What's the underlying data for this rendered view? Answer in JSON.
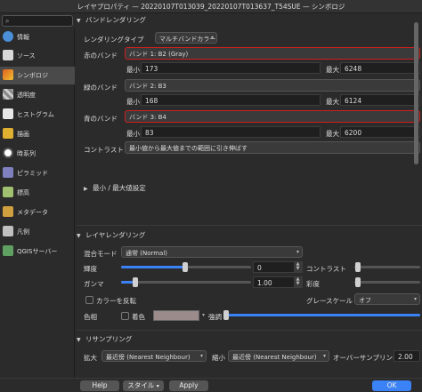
{
  "window": {
    "title": "レイヤプロパティ — 20220107T013039_20220107T013637_T54SUE — シンボロジ"
  },
  "sidebar": {
    "search_placeholder": "",
    "items": [
      {
        "label": "情報",
        "icon": "info-icon",
        "color": "#4a90d9"
      },
      {
        "label": "ソース",
        "icon": "source-icon",
        "color": "#e0e0e0"
      },
      {
        "label": "シンボロジ",
        "icon": "symbology-icon",
        "color": "#e06020"
      },
      {
        "label": "透明度",
        "icon": "transparency-icon",
        "color": "#8a8a8a"
      },
      {
        "label": "ヒストグラム",
        "icon": "histogram-icon",
        "color": "#6aa0d0"
      },
      {
        "label": "描画",
        "icon": "rendering-icon",
        "color": "#e0b030"
      },
      {
        "label": "時系列",
        "icon": "temporal-icon",
        "color": "#e0e0e0"
      },
      {
        "label": "ピラミッド",
        "icon": "pyramid-icon",
        "color": "#8080c0"
      },
      {
        "label": "標高",
        "icon": "elevation-icon",
        "color": "#a0c070"
      },
      {
        "label": "メタデータ",
        "icon": "metadata-icon",
        "color": "#d0a040"
      },
      {
        "label": "凡例",
        "icon": "legend-icon",
        "color": "#c0c0c0"
      },
      {
        "label": "QGISサーバー",
        "icon": "server-icon",
        "color": "#60a060"
      }
    ]
  },
  "band_rendering": {
    "header": "バンドレンダリング",
    "render_type_label": "レンダリングタイプ",
    "render_type_value": "マルチバンドカラー",
    "red_label": "赤のバンド",
    "red_value": "バンド 1: B2 (Gray)",
    "red_min_label": "最小",
    "red_min": "173",
    "red_max_label": "最大",
    "red_max": "6248",
    "green_label": "緑のバンド",
    "green_value": "バンド 2: B3",
    "green_min_label": "最小",
    "green_min": "168",
    "green_max_label": "最大",
    "green_max": "6124",
    "blue_label": "青のバンド",
    "blue_value": "バンド 3: B4",
    "blue_min_label": "最小",
    "blue_min": "83",
    "blue_max_label": "最大",
    "blue_max": "6200",
    "contrast_label": "コントラスト",
    "contrast_value": "最小値から最大値までの範囲に引き伸ばす",
    "minmax_label": "最小 / 最大値設定"
  },
  "layer_rendering": {
    "header": "レイヤレンダリング",
    "blend_label": "混合モード",
    "blend_value": "通常 (Normal)",
    "brightness_label": "輝度",
    "brightness_value": "0",
    "contrast_label": "コントラスト",
    "gamma_label": "ガンマ",
    "gamma_value": "1.00",
    "saturation_label": "彩度",
    "invert_label": "カラーを反転",
    "grayscale_label": "グレースケール",
    "grayscale_value": "オフ",
    "hue_label": "色相",
    "colorize_label": "着色",
    "strength_label": "強調"
  },
  "resampling": {
    "header": "リサンプリング",
    "zoomin_label": "拡大",
    "zoomin_value": "最近傍 (Nearest Neighbour)",
    "zoomout_label": "縮小",
    "zoomout_value": "最近傍 (Nearest Neighbour)",
    "oversampling_label": "オーバーサンプリング",
    "oversampling_value": "2.00"
  },
  "buttons": {
    "help": "Help",
    "style": "スタイル",
    "apply": "Apply",
    "ok": "OK"
  }
}
